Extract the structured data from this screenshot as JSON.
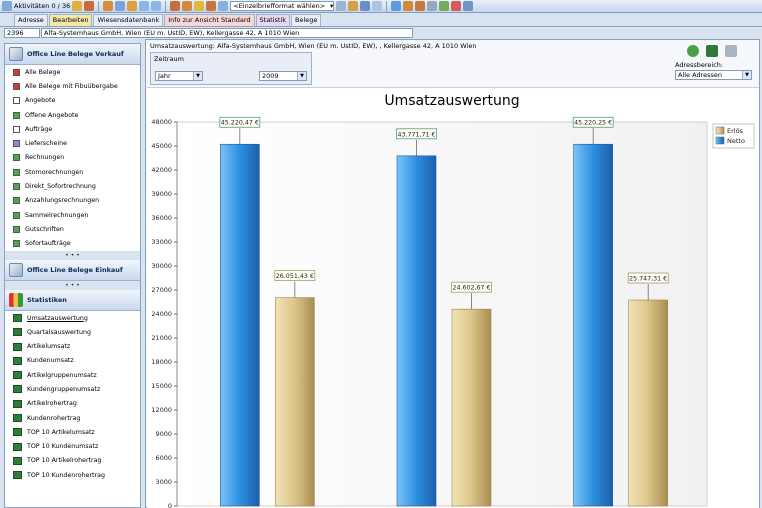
{
  "toolbar": {
    "activity_label": "Aktivitäten 0 / 36",
    "template_select": "<Einzelbriefformat wählen>"
  },
  "tabs": [
    {
      "label": "Adresse",
      "color": "#e8eef7"
    },
    {
      "label": "Bearbeiten",
      "color": "#f4e8a6"
    },
    {
      "label": "Wiesensdatenbank",
      "color": "#e8eef7"
    },
    {
      "label": "Info zur Ansicht Standard",
      "color": "#f7d6d6"
    },
    {
      "label": "Statistik",
      "color": "#e8d7f2"
    },
    {
      "label": "Belege",
      "color": "#e8eef7"
    }
  ],
  "address": {
    "id": "2396",
    "name": "Alfa-Systemhaus GmbH, Wien (EU m. UstID, EW), Kellergasse 42, A 1010 Wien"
  },
  "sidebar": {
    "sales_header": "Office Line Belege Verkauf",
    "sales_items": [
      {
        "label": "Alle Belege",
        "icon": "red-doc-icon",
        "color": "#d33b3b"
      },
      {
        "label": "Alle Belege mit Fibuübergabe",
        "icon": "red-doc-icon",
        "color": "#d33b3b"
      },
      {
        "label": "Angebote",
        "icon": "blank-doc-icon",
        "color": "#ffffff"
      },
      {
        "label": "Offene Angebote",
        "icon": "green-doc-icon",
        "color": "#4aa84a"
      },
      {
        "label": "Aufträge",
        "icon": "blank-doc-icon",
        "color": "#ffffff"
      },
      {
        "label": "Lieferscheine",
        "icon": "purple-doc-icon",
        "color": "#9c87d6"
      },
      {
        "label": "Rechnungen",
        "icon": "green-doc-icon",
        "color": "#4aa84a"
      },
      {
        "label": "Stornorechnungen",
        "icon": "green-doc-icon",
        "color": "#4aa84a"
      },
      {
        "label": "Direkt_Sofortrechnung",
        "icon": "green-doc-icon",
        "color": "#4aa84a"
      },
      {
        "label": "Anzahlungsrechnungen",
        "icon": "green-doc-icon",
        "color": "#4aa84a"
      },
      {
        "label": "Sammelrechnungen",
        "icon": "green-doc-icon",
        "color": "#4aa84a"
      },
      {
        "label": "Gutschriften",
        "icon": "green-doc-icon",
        "color": "#4aa84a"
      },
      {
        "label": "Sofortaufträge",
        "icon": "green-doc-icon",
        "color": "#4aa84a"
      }
    ],
    "purchase_header": "Office Line Belege Einkauf",
    "stats_header": "Statistiken",
    "stats_items": [
      "Umsatzauswertung",
      "Quartalsauswertung",
      "Artikelumsatz",
      "Kundenumsatz",
      "Artikelgruppenumsatz",
      "Kundengruppenumsatz",
      "Artikelrohertrag",
      "Kundenrohertrag",
      "TOP 10 Artikelumsatz",
      "TOP 10 Kundenumsatz",
      "TOP 10 Artikelrohertrag",
      "TOP 10 Kundenrohertrag"
    ],
    "divider_dots": "• • •"
  },
  "main": {
    "title": "Umsatzauswertung: Alfa-Systemhaus GmbH, Wien (EU m. UstID, EW), , Kellergasse 42, A 1010 Wien",
    "period_label": "Zeitraum",
    "period_type": "Jahr",
    "year": "2009",
    "address_range_label": "Adressbereich:",
    "address_range_value": "Alle Adressen"
  },
  "chart_data": {
    "type": "bar",
    "title": "Umsatzauswertung",
    "xlabel": "",
    "ylabel": "",
    "ylim": [
      0,
      48000
    ],
    "yticks": [
      0,
      3000,
      6000,
      9000,
      12000,
      15000,
      18000,
      21000,
      24000,
      27000,
      30000,
      33000,
      36000,
      39000,
      42000,
      45000,
      48000
    ],
    "grid": false,
    "legend": "top-right",
    "categories": [
      "",
      "",
      ""
    ],
    "series": [
      {
        "name": "Netto",
        "color": "#2d8fe0",
        "values": [
          45220.47,
          43771.71,
          45220.25
        ],
        "labels": [
          "45.220,47 €",
          "43.771,71 €",
          "45.220,25 €"
        ]
      },
      {
        "name": "Erlös",
        "color": "#dcc58a",
        "values": [
          26051.43,
          24602.67,
          25747.31
        ],
        "labels": [
          "26.051,43 €",
          "24.602,67 €",
          "25.747,31 €"
        ]
      }
    ]
  }
}
